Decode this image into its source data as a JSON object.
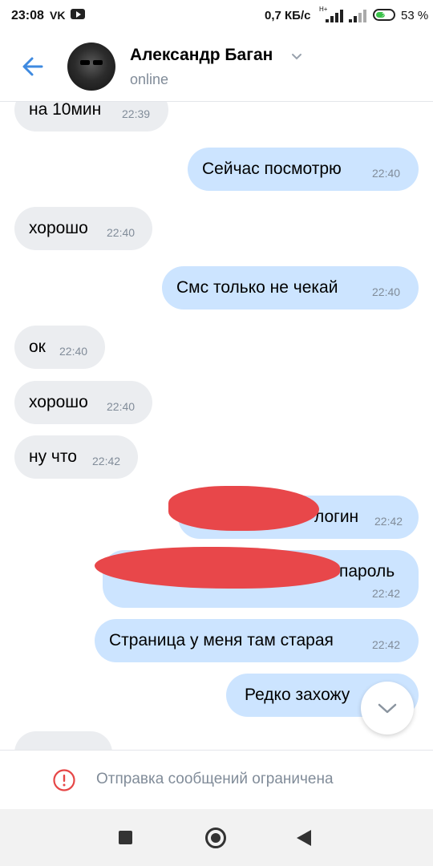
{
  "status_bar": {
    "time": "23:08",
    "vk_label": "VK",
    "speed": "0,7 КБ/с",
    "net_label": "H+",
    "battery": "53 %",
    "battery_level": 0.53
  },
  "header": {
    "name": "Александр Баган",
    "status": "online"
  },
  "messages": [
    {
      "dir": "in",
      "text": "на 10мин",
      "time": "22:39"
    },
    {
      "dir": "out",
      "text": "Сейчас посмотрю",
      "time": "22:40"
    },
    {
      "dir": "in",
      "text": "хорошо",
      "time": "22:40"
    },
    {
      "dir": "out",
      "text": "Смс только не чекай",
      "time": "22:40"
    },
    {
      "dir": "in",
      "text": "ок",
      "time": "22:40"
    },
    {
      "dir": "in",
      "text": "хорошо",
      "time": "22:40"
    },
    {
      "dir": "in",
      "text": "ну что",
      "time": "22:42"
    },
    {
      "dir": "out",
      "text": "логин",
      "time": "22:42"
    },
    {
      "dir": "out",
      "text": "пароль",
      "time": "22:42"
    },
    {
      "dir": "out",
      "text": "Страница у меня там старая",
      "time": "22:42"
    },
    {
      "dir": "out",
      "text": "Редко захожу",
      "time": ""
    }
  ],
  "footer": {
    "text": "Отправка сообщений ограничена"
  },
  "colors": {
    "accent": "#3f8ae0",
    "incoming_bubble": "#ebedf0",
    "outgoing_bubble": "#cce4ff",
    "secondary_text": "#818c99",
    "warning": "#e64646",
    "redaction": "#e8474a"
  },
  "icons": [
    "back-arrow-icon",
    "chevron-down-icon",
    "scroll-down-icon",
    "warning-icon",
    "recent-apps-icon",
    "home-icon",
    "nav-back-icon"
  ]
}
